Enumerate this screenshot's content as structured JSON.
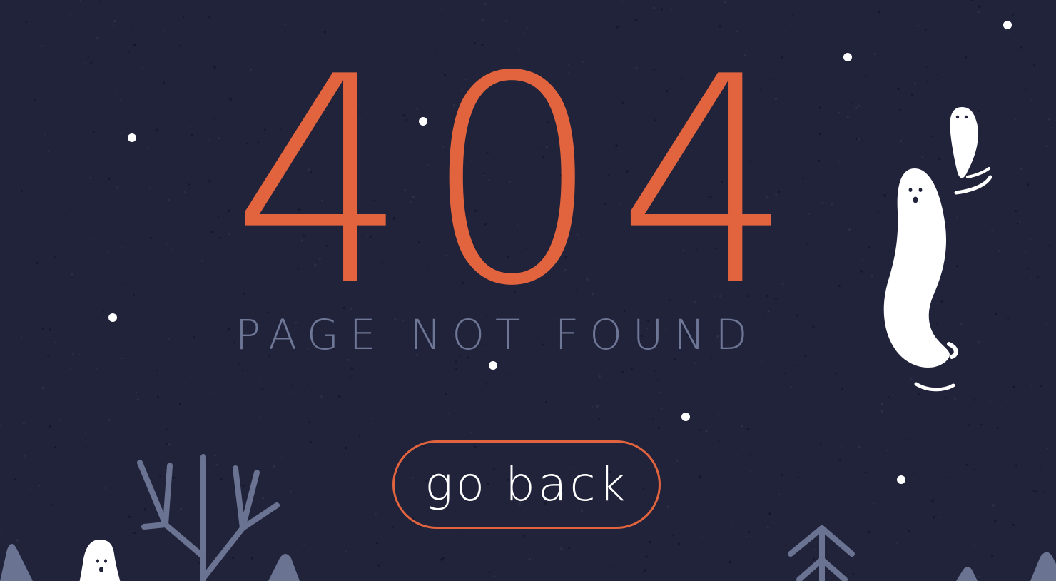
{
  "error": {
    "code": "404",
    "message": "PAGE NOT FOUND"
  },
  "actions": {
    "go_back_label": "go back"
  },
  "colors": {
    "background": "#21233a",
    "accent": "#e2643e",
    "muted_text": "#6e7796",
    "ghost": "#ffffff",
    "tree": "#6a7391"
  },
  "decorations": {
    "icons": [
      "ghost-icon",
      "tree-icon",
      "star-icon"
    ]
  }
}
